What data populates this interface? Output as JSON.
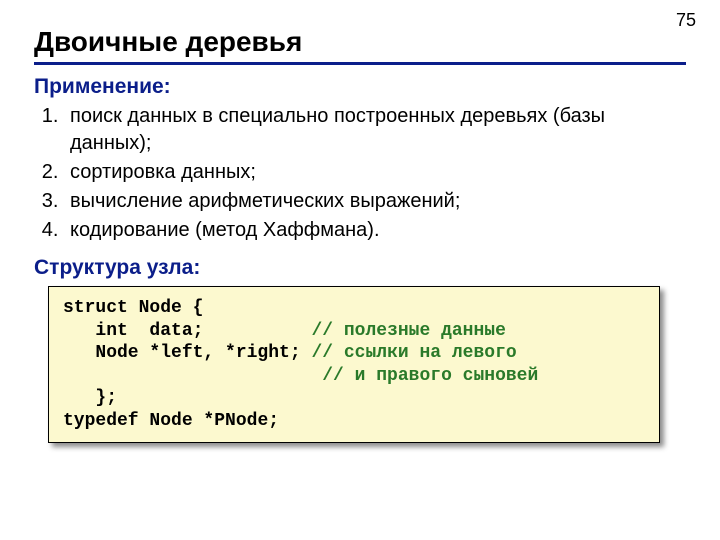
{
  "page_number": "75",
  "title": "Двоичные деревья",
  "sections": {
    "applications_label": "Применение:",
    "applications": [
      "поиск данных в специально построенных деревьях (базы данных);",
      "сортировка данных;",
      "вычисление арифметических выражений;",
      "кодирование (метод Хаффмана)."
    ],
    "node_struct_label": "Структура узла:"
  },
  "code": {
    "l1_a": "struct",
    "l1_b": " Node {",
    "l2_a": "   ",
    "l2_b": "int",
    "l2_c": "  data;          ",
    "l2_d": "// полезные данные",
    "l3_a": "   Node *left, *right; ",
    "l3_b": "// ссылки на левого",
    "l4_a": "                        ",
    "l4_b": "// и правого сыновей",
    "l5": "   };",
    "l6_a": "typedef",
    "l6_b": " Node *PNode;"
  }
}
